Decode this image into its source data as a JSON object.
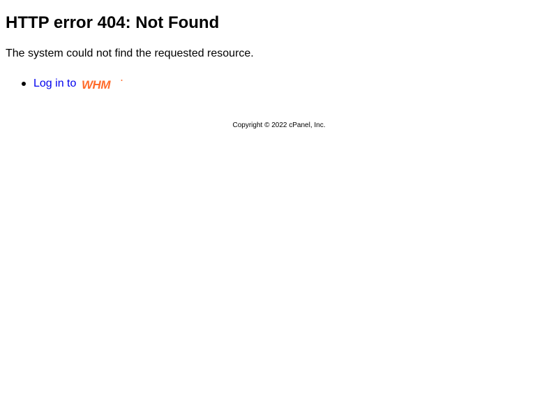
{
  "heading": "HTTP error 404: Not Found",
  "message": "The system could not find the requested resource.",
  "links": [
    {
      "label": "Log in to",
      "logo": "WHM",
      "logo_color": "#ff6c2c"
    }
  ],
  "footer": {
    "copyright": "Copyright © 2022 cPanel, Inc."
  },
  "colors": {
    "link": "#0000ee",
    "text": "#000000",
    "background": "#ffffff"
  }
}
